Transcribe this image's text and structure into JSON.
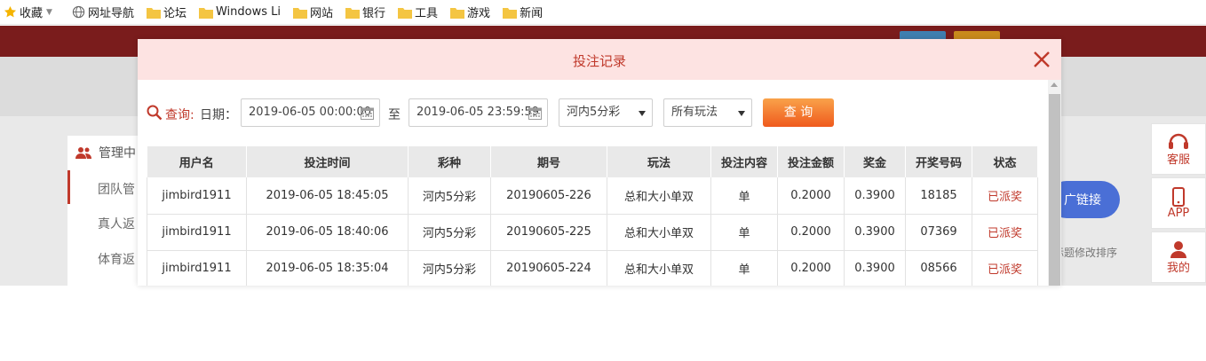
{
  "bookmarks": {
    "favorites_label": "收藏",
    "items": [
      {
        "label": "网址导航",
        "icon": "globe-icon"
      },
      {
        "label": "论坛",
        "icon": "folder-icon"
      },
      {
        "label": "Windows Li",
        "icon": "folder-icon"
      },
      {
        "label": "网站",
        "icon": "folder-icon"
      },
      {
        "label": "银行",
        "icon": "folder-icon"
      },
      {
        "label": "工具",
        "icon": "folder-icon"
      },
      {
        "label": "游戏",
        "icon": "folder-icon"
      },
      {
        "label": "新闻",
        "icon": "folder-icon"
      }
    ]
  },
  "background": {
    "sidebar_title": "管理中",
    "sidebar_items": [
      "团队管",
      "真人返",
      "体育返"
    ],
    "dock": [
      "客服",
      "APP",
      "我的"
    ],
    "promo_button": "广链接",
    "hint_text": "标题修改排序"
  },
  "modal": {
    "title": "投注记录",
    "filter": {
      "query_label": "查询:",
      "date_label": "日期：",
      "start_date": "2019-06-05 00:00:00",
      "to_label": "至",
      "end_date": "2019-06-05 23:59:59",
      "lottery_select": "河内5分彩",
      "play_select": "所有玩法",
      "query_button": "查 询"
    },
    "table": {
      "headers": [
        "用户名",
        "投注时间",
        "彩种",
        "期号",
        "玩法",
        "投注内容",
        "投注金额",
        "奖金",
        "开奖号码",
        "状态"
      ],
      "rows": [
        [
          "jimbird1911",
          "2019-06-05 18:45:05",
          "河内5分彩",
          "20190605-226",
          "总和大小单双",
          "单",
          "0.2000",
          "0.3900",
          "18185",
          "已派奖"
        ],
        [
          "jimbird1911",
          "2019-06-05 18:40:06",
          "河内5分彩",
          "20190605-225",
          "总和大小单双",
          "单",
          "0.2000",
          "0.3900",
          "07369",
          "已派奖"
        ],
        [
          "jimbird1911",
          "2019-06-05 18:35:04",
          "河内5分彩",
          "20190605-224",
          "总和大小单双",
          "单",
          "0.2000",
          "0.3900",
          "08566",
          "已派奖"
        ]
      ]
    }
  },
  "colors": {
    "accent": "#c0392b",
    "header_bg": "#fde3e2",
    "query_button": "#f07a2f",
    "nav_bg": "#7a1c1c"
  }
}
